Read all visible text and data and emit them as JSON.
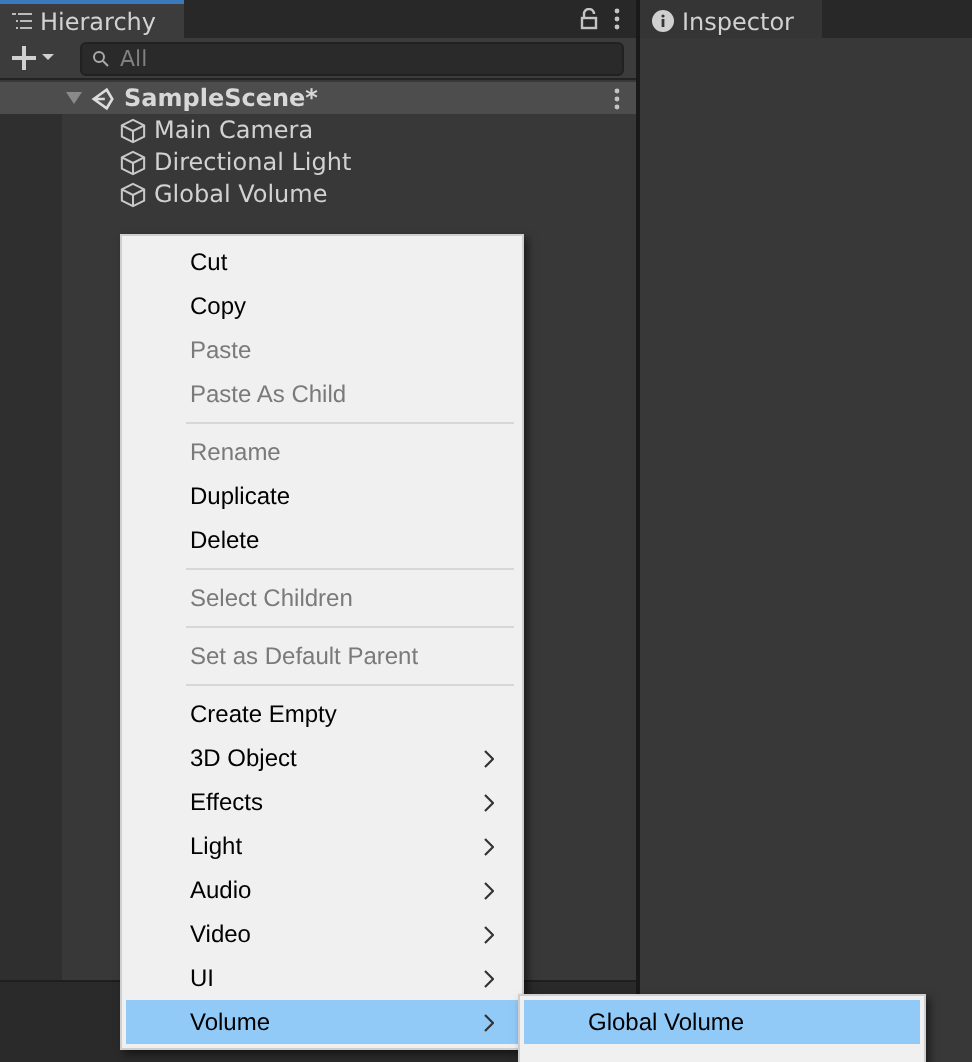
{
  "hierarchy": {
    "tab": {
      "label": "Hierarchy",
      "selected": true
    },
    "search": {
      "placeholder": "All"
    },
    "scene": {
      "name": "SampleScene*",
      "expanded": true
    },
    "objects": [
      {
        "name": "Main Camera"
      },
      {
        "name": "Directional Light"
      },
      {
        "name": "Global Volume"
      }
    ]
  },
  "inspector": {
    "tab": {
      "label": "Inspector",
      "selected": false
    }
  },
  "context_menu": {
    "items": [
      {
        "kind": "item",
        "label": "Cut",
        "disabled": false,
        "submenu": false,
        "selected": false
      },
      {
        "kind": "item",
        "label": "Copy",
        "disabled": false,
        "submenu": false,
        "selected": false
      },
      {
        "kind": "item",
        "label": "Paste",
        "disabled": true,
        "submenu": false,
        "selected": false
      },
      {
        "kind": "item",
        "label": "Paste As Child",
        "disabled": true,
        "submenu": false,
        "selected": false
      },
      {
        "kind": "separator"
      },
      {
        "kind": "item",
        "label": "Rename",
        "disabled": true,
        "submenu": false,
        "selected": false
      },
      {
        "kind": "item",
        "label": "Duplicate",
        "disabled": false,
        "submenu": false,
        "selected": false
      },
      {
        "kind": "item",
        "label": "Delete",
        "disabled": false,
        "submenu": false,
        "selected": false
      },
      {
        "kind": "separator"
      },
      {
        "kind": "item",
        "label": "Select Children",
        "disabled": true,
        "submenu": false,
        "selected": false
      },
      {
        "kind": "separator"
      },
      {
        "kind": "item",
        "label": "Set as Default Parent",
        "disabled": true,
        "submenu": false,
        "selected": false
      },
      {
        "kind": "separator"
      },
      {
        "kind": "item",
        "label": "Create Empty",
        "disabled": false,
        "submenu": false,
        "selected": false
      },
      {
        "kind": "item",
        "label": "3D Object",
        "disabled": false,
        "submenu": true,
        "selected": false
      },
      {
        "kind": "item",
        "label": "Effects",
        "disabled": false,
        "submenu": true,
        "selected": false
      },
      {
        "kind": "item",
        "label": "Light",
        "disabled": false,
        "submenu": true,
        "selected": false
      },
      {
        "kind": "item",
        "label": "Audio",
        "disabled": false,
        "submenu": true,
        "selected": false
      },
      {
        "kind": "item",
        "label": "Video",
        "disabled": false,
        "submenu": true,
        "selected": false
      },
      {
        "kind": "item",
        "label": "UI",
        "disabled": false,
        "submenu": true,
        "selected": false
      },
      {
        "kind": "item",
        "label": "Volume",
        "disabled": false,
        "submenu": true,
        "selected": true
      }
    ]
  },
  "submenu": {
    "items": [
      {
        "label": "Global Volume",
        "selected": true
      }
    ]
  }
}
